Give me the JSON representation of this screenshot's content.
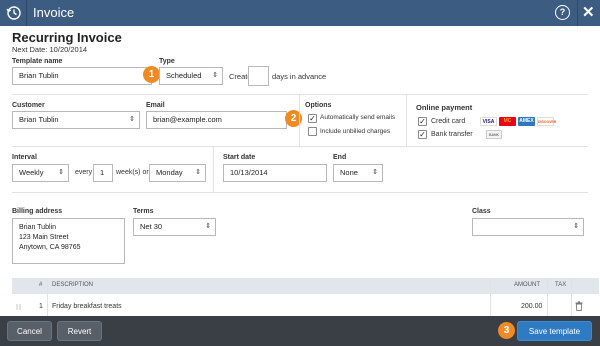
{
  "window": {
    "title": "Invoice",
    "help_label": "?",
    "close_label": "✕"
  },
  "heading": "Recurring Invoice",
  "next_date": "Next Date: 10/20/2014",
  "template": {
    "name_label": "Template name",
    "name_value": "Brian Tublin",
    "type_label": "Type",
    "type_value": "Scheduled",
    "create_label": "Create",
    "create_value": "",
    "days_label": "days in advance"
  },
  "customer": {
    "label": "Customer",
    "value": "Brian Tublin",
    "email_label": "Email",
    "email_value": "brian@example.com"
  },
  "options": {
    "label": "Options",
    "auto_send_label": "Automatically send emails",
    "auto_send_checked": true,
    "unbilled_label": "Include unbilled charges",
    "unbilled_checked": false
  },
  "online_payment": {
    "label": "Online payment",
    "credit_card_label": "Credit card",
    "credit_card_checked": true,
    "bank_transfer_label": "Bank transfer",
    "bank_transfer_checked": true,
    "card_logos": [
      "VISA",
      "MC",
      "AMEX",
      "DISCOVER"
    ],
    "bank_logo": "BANK"
  },
  "interval": {
    "label": "Interval",
    "value": "Weekly",
    "every_label": "every",
    "every_value": "1",
    "weeks_label": "week(s) on",
    "day_value": "Monday"
  },
  "start_date": {
    "label": "Start date",
    "value": "10/13/2014"
  },
  "end": {
    "label": "End",
    "value": "None"
  },
  "billing": {
    "label": "Billing address",
    "lines": [
      "Brian Tublin",
      "123 Main Street",
      "Anytown, CA 98765"
    ]
  },
  "terms": {
    "label": "Terms",
    "value": "Net 30"
  },
  "class": {
    "label": "Class",
    "value": ""
  },
  "table": {
    "headers": {
      "num": "#",
      "description": "DESCRIPTION",
      "amount": "AMOUNT",
      "tax": "TAX"
    },
    "rows": [
      {
        "num": "1",
        "description": "Friday breakfast treats",
        "amount": "200.00"
      }
    ]
  },
  "footer": {
    "cancel": "Cancel",
    "revert": "Revert",
    "save": "Save template"
  },
  "callouts": [
    "1",
    "2",
    "3"
  ],
  "colors": {
    "titlebar": "#3d5c82",
    "callout": "#f08a24",
    "footer": "#3a3f46",
    "primary_button": "#2e7bc4"
  }
}
